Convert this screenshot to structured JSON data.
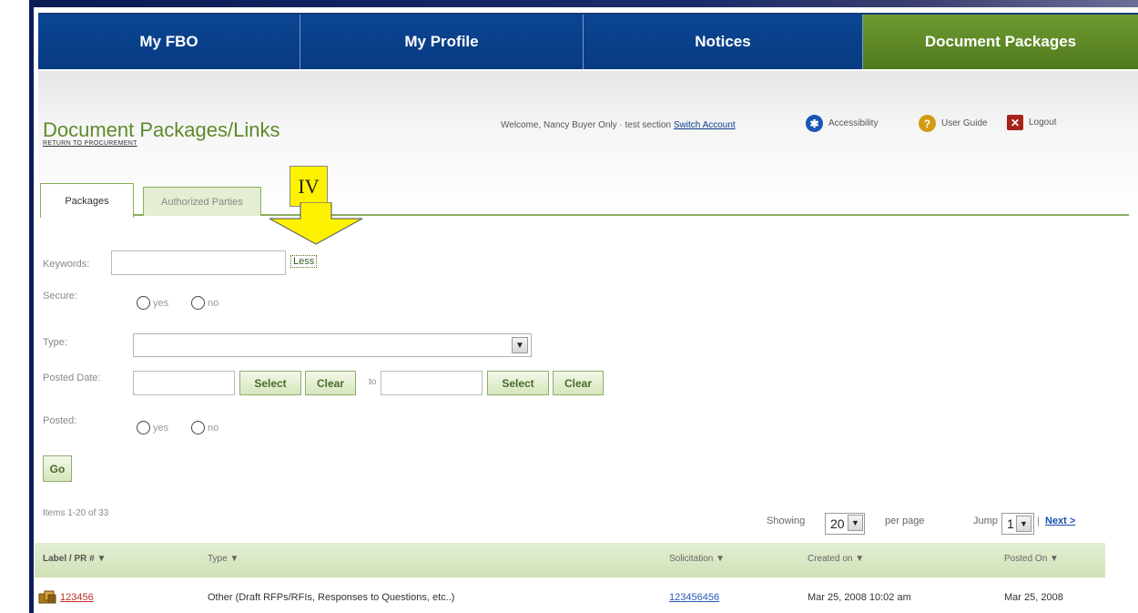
{
  "nav": {
    "tabs": [
      {
        "label": "My FBO"
      },
      {
        "label": "My Profile"
      },
      {
        "label": "Notices"
      },
      {
        "label": "Document Packages"
      }
    ]
  },
  "header": {
    "welcome_text": "Welcome, Nancy Buyer Only · test section",
    "switch_account": "Switch Account",
    "accessibility": "Accessibility",
    "user_guide": "User Guide",
    "logout": "Logout",
    "title": "Document Packages/Links",
    "return_link": "RETURN TO PROCUREMENT"
  },
  "subtabs": {
    "packages": "Packages",
    "authorized": "Authorized Parties"
  },
  "annotation": {
    "label": "IV"
  },
  "form": {
    "keywords_label": "Keywords:",
    "keywords_value": "",
    "less_link": "Less",
    "secure_label": "Secure:",
    "yes": "yes",
    "no": "no",
    "type_label": "Type:",
    "type_value": "",
    "posted_date_label": "Posted Date:",
    "select_btn": "Select",
    "clear_btn": "Clear",
    "to_label": "to",
    "posted_label": "Posted:",
    "go_btn": "Go"
  },
  "results": {
    "items_count": "Items 1-20 of 33",
    "showing_label": "Showing",
    "per_page_value": "20",
    "per_page_label": "per page",
    "jump_label": "Jump",
    "jump_value": "1",
    "separator": "|",
    "next_link": "Next >"
  },
  "table": {
    "headers": [
      "Label / PR # ▼",
      "Type ▼",
      "Solicitation ▼",
      "Created on ▼",
      "Posted On ▼"
    ],
    "rows": [
      {
        "label": "123456",
        "type": "Other (Draft RFPs/RFIs, Responses to Questions, etc..)",
        "solicitation": "123456456",
        "created": "Mar 25, 2008 10:02 am",
        "posted": "Mar 25, 2008"
      }
    ]
  },
  "colors": {
    "nav_blue": "#0b4692",
    "nav_active_green": "#6e9a32",
    "title_green": "#5e8a2a",
    "annotation_yellow": "#fff200"
  }
}
